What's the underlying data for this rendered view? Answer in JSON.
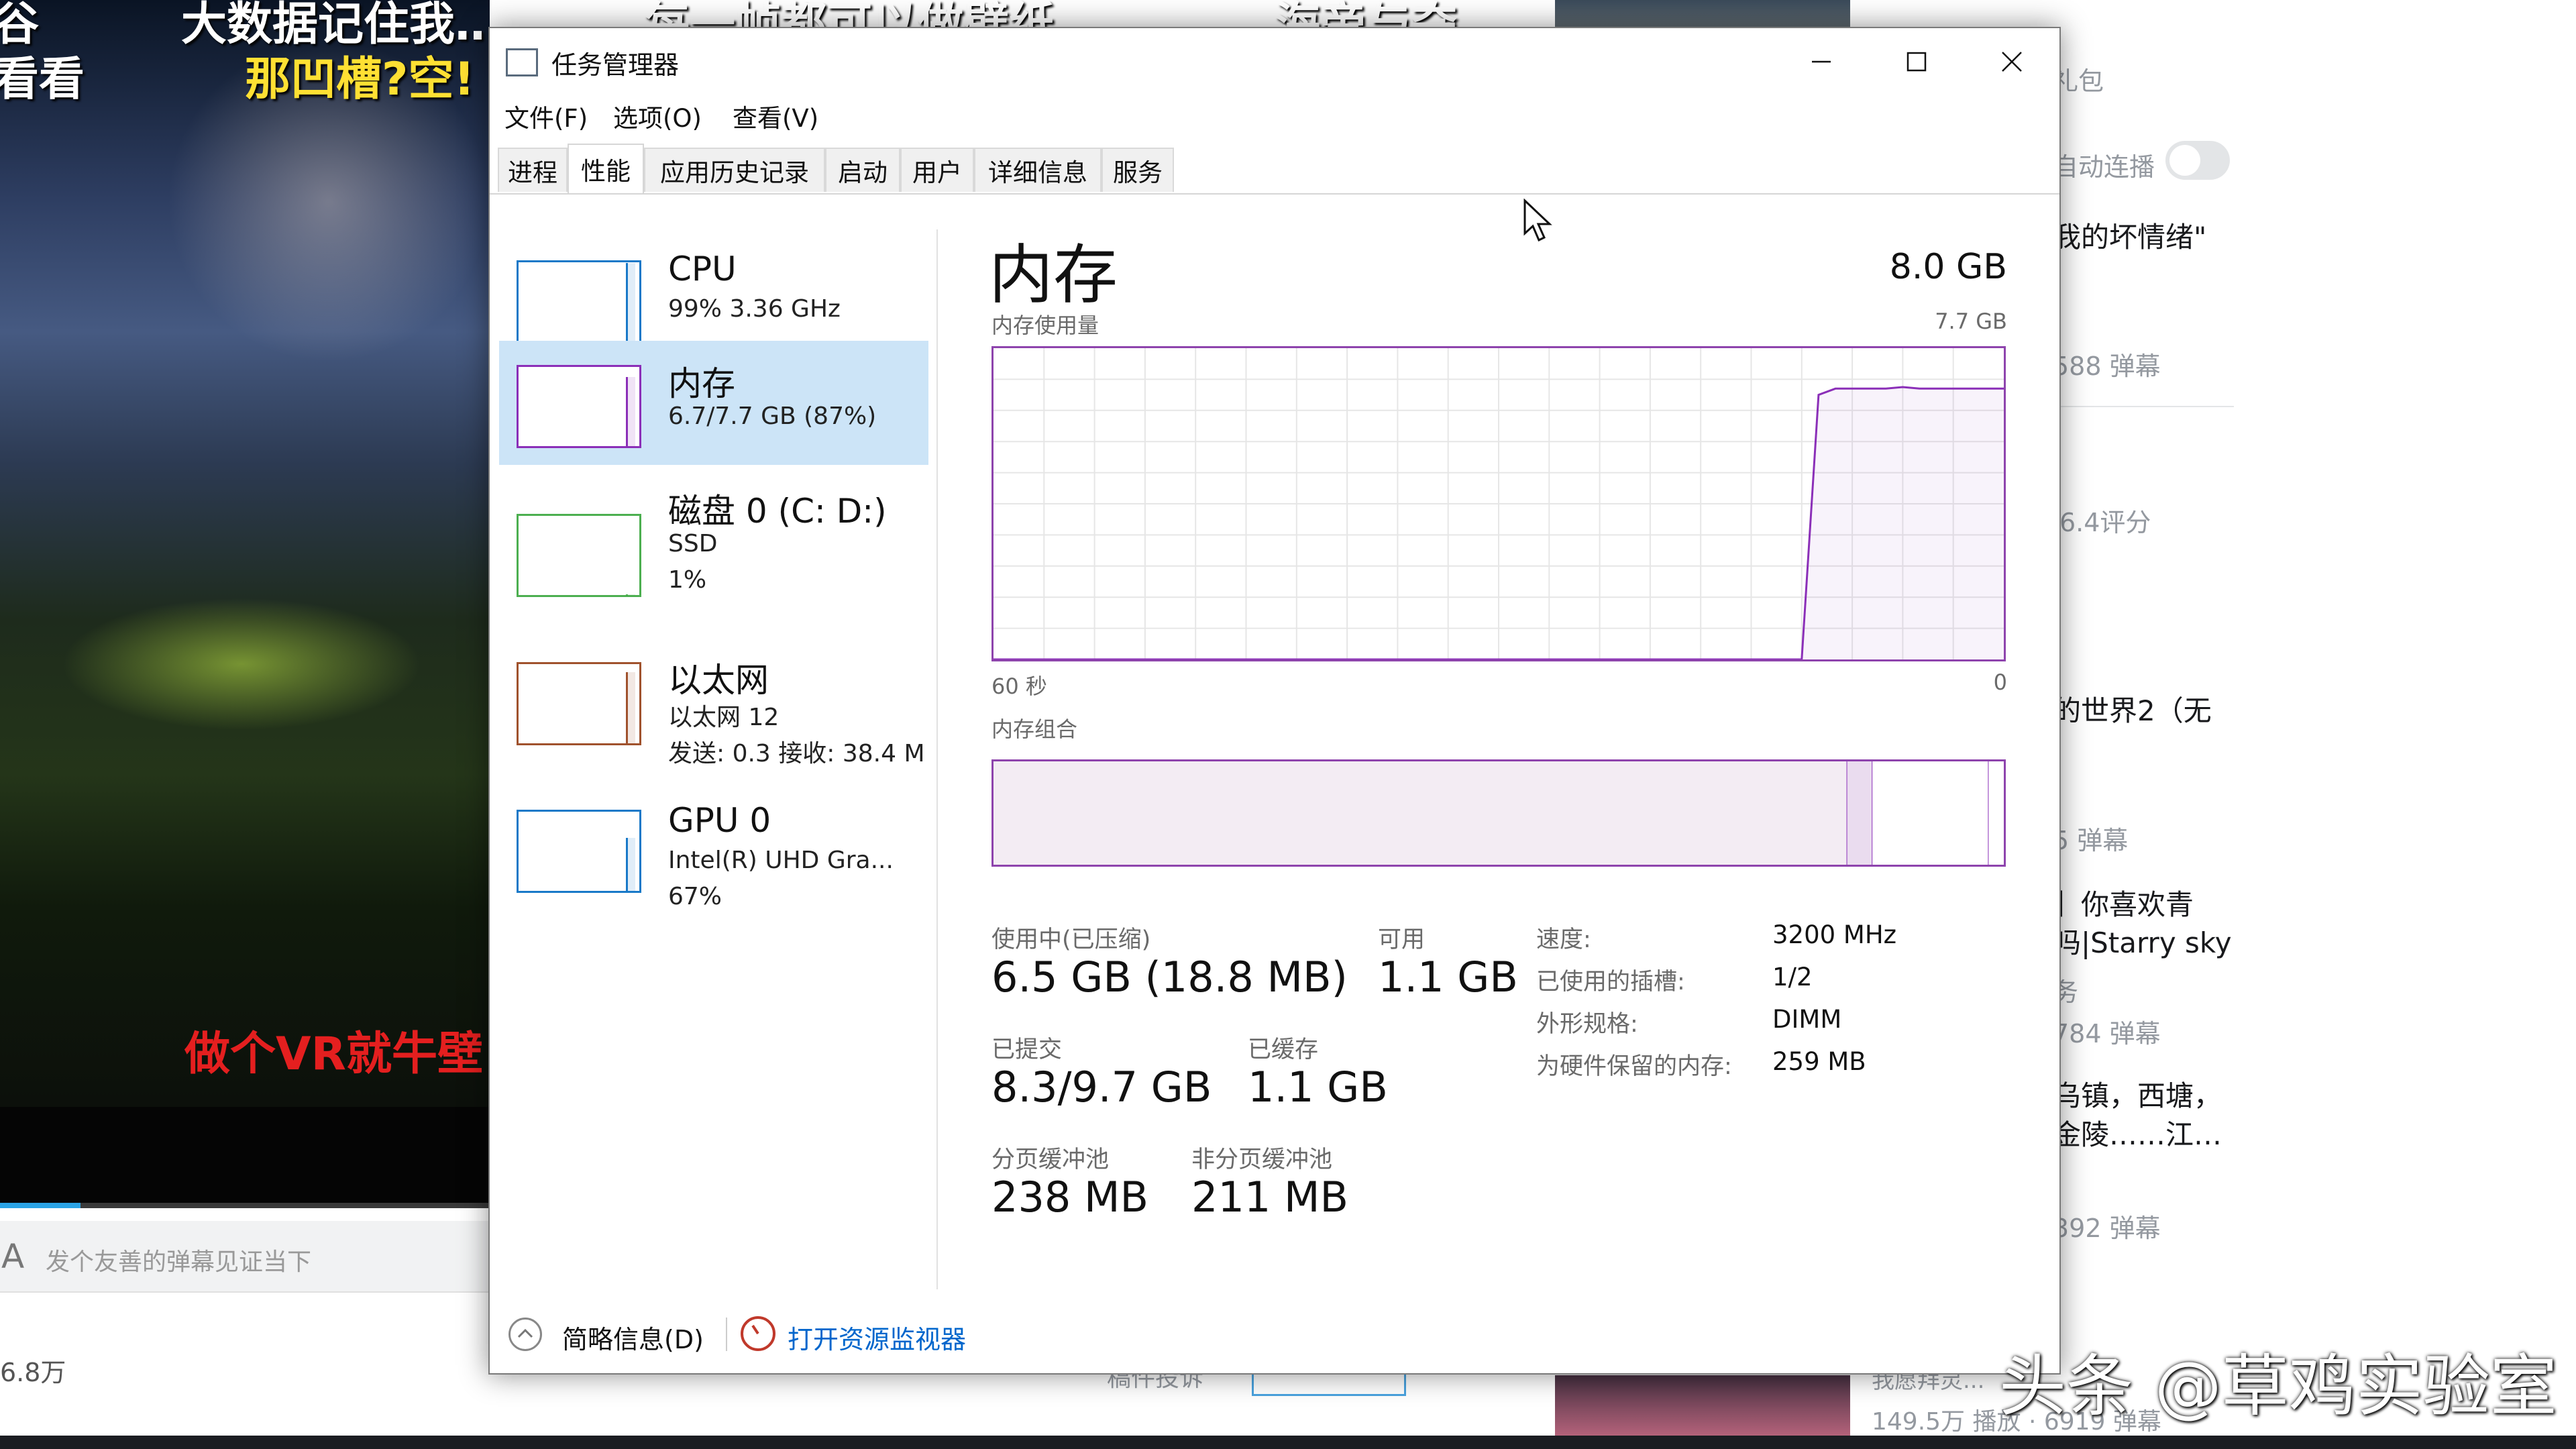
{
  "background_page": {
    "video_overlay_texts": [
      "谷",
      "大数据记住我……",
      "每一帧都可以做壁纸",
      "海帝与夺",
      "看看",
      "那凹槽?空!",
      "做个VR就牛壁"
    ],
    "danmaku_icon": "A",
    "danmaku_placeholder": "发个友善的弹幕见证当下",
    "view_count": "6.8万",
    "right_panel": {
      "gift": "礼包",
      "autoplay": "自动连播",
      "item1_title": "我的坏情绪\"",
      "item1_meta": "588 弹幕",
      "item2_meta": "6.4评分",
      "item3_title": "的世界2（无",
      "item3_meta": "5 弹幕",
      "item4_title_line1": "】你喜欢青",
      "item4_title_line2": "吗|Starry sky",
      "item4_meta_a": "务",
      "item4_meta": "784 弹幕",
      "item5_title_line1": "乌镇，西塘，",
      "item5_title_line2": "金陵……江…",
      "item5_meta": "392 弹幕",
      "bottom_title": "我愿拜灵...",
      "bottom_meta": "149.5万 播放 · 6919 弹幕"
    },
    "below_video_text": "稿件投诉",
    "watermark": "头条 @草鸡实验室"
  },
  "window": {
    "title": "任务管理器",
    "icon": "task-manager-icon",
    "menu": [
      "文件(F)",
      "选项(O)",
      "查看(V)"
    ],
    "tabs": [
      "进程",
      "性能",
      "应用历史记录",
      "启动",
      "用户",
      "详细信息",
      "服务"
    ],
    "active_tab": "性能"
  },
  "sidebar": {
    "items": [
      {
        "title": "CPU",
        "line1": "99% 3.36 GHz",
        "line2": "",
        "color": "#1979c8",
        "level": 0.99
      },
      {
        "title": "内存",
        "line1": "6.7/7.7 GB (87%)",
        "line2": "",
        "color": "#8b2fb8",
        "level": 0.87
      },
      {
        "title": "磁盘 0 (C: D:)",
        "line1": "SSD",
        "line2": "1%",
        "color": "#4caf50",
        "level": 0.01
      },
      {
        "title": "以太网",
        "line1": "以太网 12",
        "line2": "发送: 0.3  接收: 38.4 M",
        "color": "#a0522d",
        "level": 0.9
      },
      {
        "title": "GPU 0",
        "line1": "Intel(R) UHD Gra...",
        "line2": "67%",
        "color": "#1979c8",
        "level": 0.67
      }
    ],
    "selected": "内存"
  },
  "memory": {
    "title": "内存",
    "total": "8.0 GB",
    "usage_label": "内存使用量",
    "usage_max": "7.7 GB",
    "axis_left": "60 秒",
    "axis_right": "0",
    "composition_label": "内存组合",
    "accent": "#8b2fb8",
    "in_use_label": "使用中(已压缩)",
    "in_use_value": "6.5 GB (18.8 MB)",
    "available_label": "可用",
    "available_value": "1.1 GB",
    "committed_label": "已提交",
    "committed_value": "8.3/9.7 GB",
    "cached_label": "已缓存",
    "cached_value": "1.1 GB",
    "paged_label": "分页缓冲池",
    "paged_value": "238 MB",
    "nonpaged_label": "非分页缓冲池",
    "nonpaged_value": "211 MB",
    "specs": [
      {
        "label": "速度:",
        "value": "3200 MHz"
      },
      {
        "label": "已使用的插槽:",
        "value": "1/2"
      },
      {
        "label": "外形规格:",
        "value": "DIMM"
      },
      {
        "label": "为硬件保留的内存:",
        "value": "259 MB"
      }
    ],
    "usage_history": [
      0,
      0,
      0,
      0,
      0,
      0,
      0,
      0,
      0,
      0,
      0,
      0,
      0,
      0,
      0,
      0,
      0,
      0,
      0,
      0,
      0,
      0,
      0,
      0,
      0,
      0,
      0,
      0,
      0,
      0,
      0,
      0,
      0,
      0,
      0,
      0,
      0,
      0,
      0,
      0,
      0,
      0,
      0,
      0,
      0,
      0,
      0,
      0,
      0,
      0.85,
      0.87,
      0.87,
      0.87,
      0.87,
      0.875,
      0.87,
      0.87,
      0.87,
      0.87,
      0.87,
      0.87
    ],
    "composition_fractions": {
      "in_use": 0.845,
      "modified": 0.025,
      "standby": 0.115,
      "free": 0.015
    }
  },
  "footer": {
    "fewer_details": "简略信息(D)",
    "open_resmon": "打开资源监视器"
  }
}
